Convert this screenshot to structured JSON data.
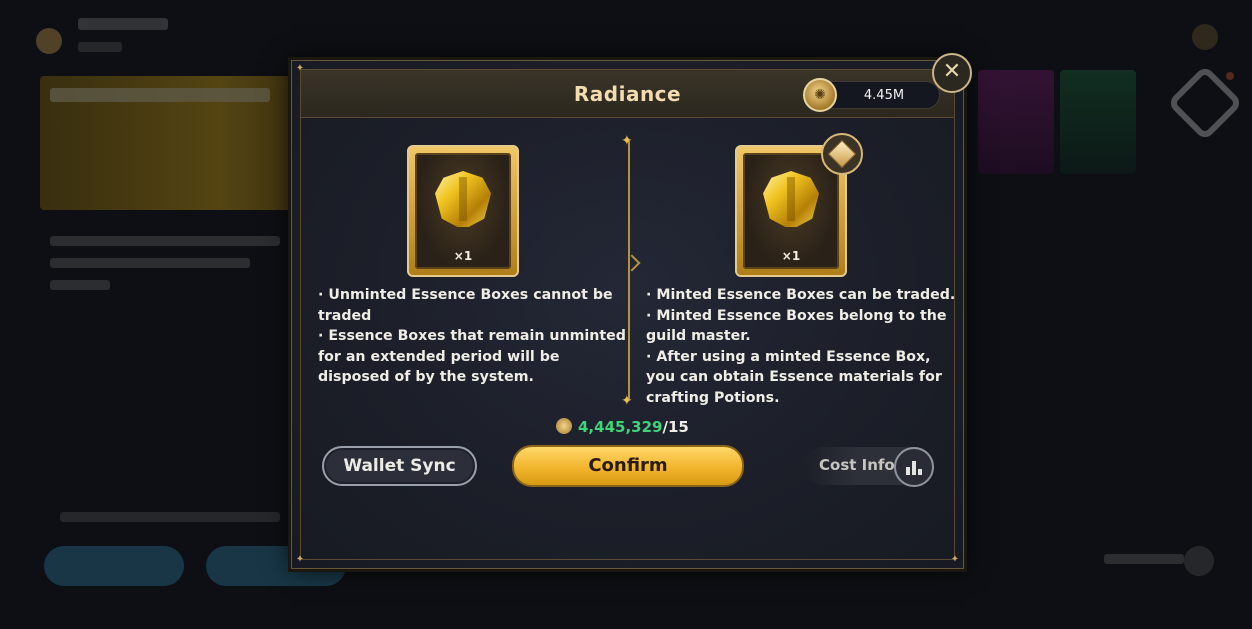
{
  "modal": {
    "title": "Radiance",
    "currency": {
      "icon": "essence-coin-icon",
      "amount": "4.45M"
    },
    "close_icon": "close-icon"
  },
  "unminted": {
    "quantity": "×1",
    "lines": [
      "· Unminted Essence Boxes cannot be traded",
      "· Essence Boxes that remain unminted for an extended period will be disposed of by the system."
    ]
  },
  "minted": {
    "quantity": "×1",
    "badge_icon": "minted-badge-icon",
    "lines": [
      "· Minted Essence Boxes can be traded.",
      "· Minted Essence Boxes belong to the guild master.",
      "· After using a minted Essence Box, you can obtain Essence materials for crafting Potions."
    ]
  },
  "cost": {
    "icon": "essence-coin-icon",
    "have": "4,445,329",
    "need": "/15"
  },
  "buttons": {
    "wallet_sync": "Wallet Sync",
    "confirm": "Confirm",
    "cost_info": "Cost Info"
  },
  "colors": {
    "accent_gold": "#f1b52c",
    "title_text": "#f3ddb0",
    "cost_have": "#3fd47a",
    "frame": "#6a5638"
  }
}
